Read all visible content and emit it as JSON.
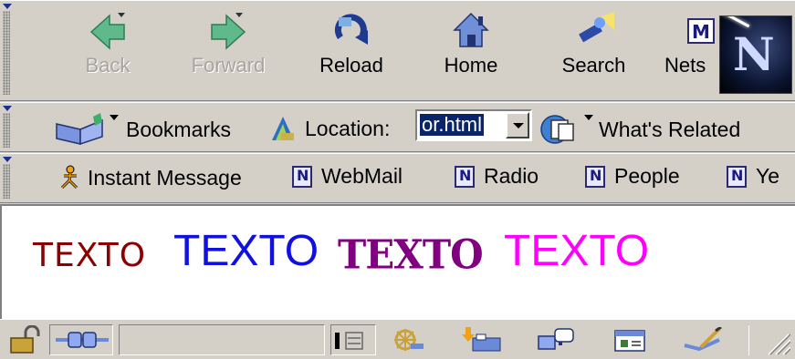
{
  "navigation_toolbar": {
    "back_label": "Back",
    "forward_label": "Forward",
    "reload_label": "Reload",
    "home_label": "Home",
    "search_label": "Search",
    "netscape_label": "Nets"
  },
  "location_toolbar": {
    "bookmarks_label": "Bookmarks",
    "location_label": "Location:",
    "location_value": "or.html",
    "whats_related_label": "What's Related"
  },
  "personal_toolbar": {
    "items": [
      "Instant Message",
      "WebMail",
      "Radio",
      "People",
      "Ye"
    ]
  },
  "page_content": {
    "words": [
      {
        "text": "TEXTO",
        "color": "#8b0000"
      },
      {
        "text": "TEXTO",
        "color": "#1010e0"
      },
      {
        "text": "TEXTO",
        "color": "#800080"
      },
      {
        "text": "TEXTO",
        "color": "#ff00ff"
      }
    ]
  },
  "status_bar": {
    "icons": [
      "security-lock-icon",
      "online-connection-icon",
      "component-bar-icon",
      "navigator-icon",
      "mail-icon",
      "instant-message-icon",
      "composer-icon",
      "address-book-icon"
    ]
  }
}
